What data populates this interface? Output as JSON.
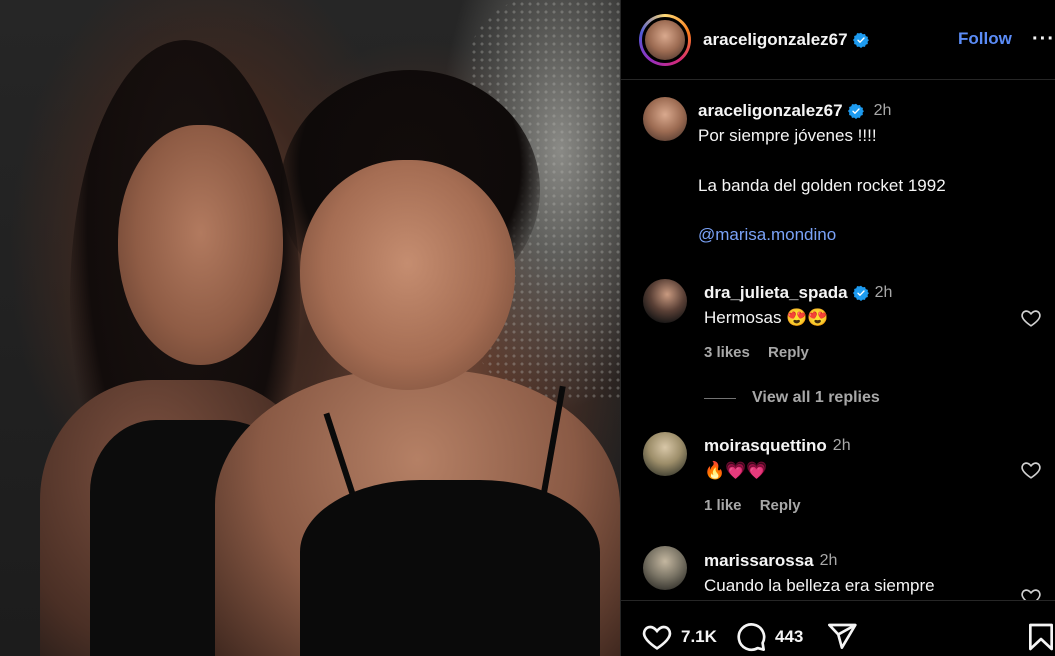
{
  "header": {
    "username": "araceligonzalez67",
    "follow_label": "Follow",
    "more_label": "···"
  },
  "caption": {
    "username": "araceligonzalez67",
    "time": "2h",
    "line1": "Por siempre jóvenes !!!!",
    "line2": "La banda del golden rocket 1992",
    "mention": "@marisa.mondino"
  },
  "comments": [
    {
      "username": "dra_julieta_spada",
      "verified": true,
      "time": "2h",
      "text": "Hermosas 😍😍",
      "likes": "3 likes",
      "reply": "Reply",
      "view_replies": "View all 1 replies"
    },
    {
      "username": "moirasquettino",
      "verified": false,
      "time": "2h",
      "text": "🔥💗💗",
      "likes": "1 like",
      "reply": "Reply"
    },
    {
      "username": "marissarossa",
      "verified": false,
      "time": "2h",
      "text": "Cuando la belleza era siempre"
    }
  ],
  "actions": {
    "like_count": "7.1K",
    "comment_count": "443"
  },
  "colors": {
    "accent": "#5b8cf7",
    "verified": "#1d9bf0",
    "muted": "#a8a8a8"
  }
}
